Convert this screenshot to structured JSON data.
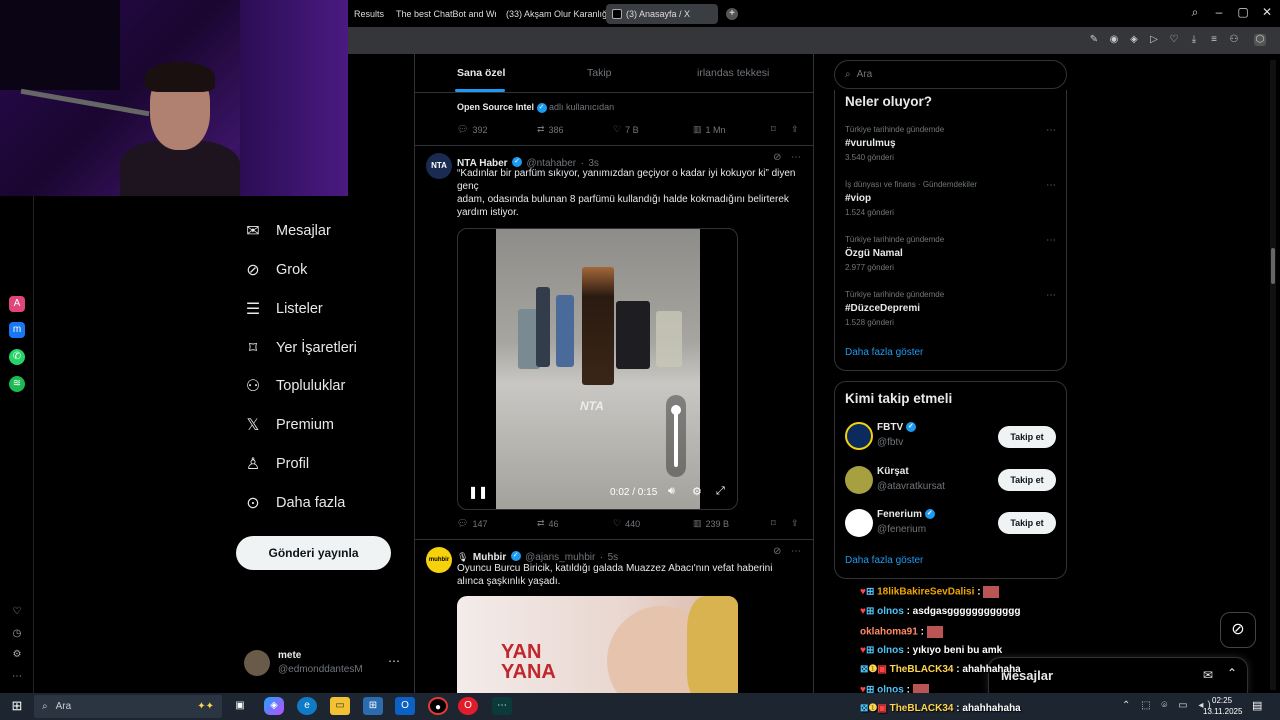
{
  "browser": {
    "tabs": [
      {
        "label": "Results"
      },
      {
        "label": "The best ChatBot and Wri"
      },
      {
        "label": "(33) Akşam Olur Karanlığa"
      },
      {
        "label": "(3) Anasayfa / X"
      }
    ]
  },
  "nav": {
    "items": [
      {
        "label": "Mesajlar",
        "icon": "mail-icon"
      },
      {
        "label": "Grok",
        "icon": "grok-icon"
      },
      {
        "label": "Listeler",
        "icon": "list-icon"
      },
      {
        "label": "Yer İşaretleri",
        "icon": "bookmark-icon"
      },
      {
        "label": "Topluluklar",
        "icon": "communities-icon"
      },
      {
        "label": "Premium",
        "icon": "x-icon"
      },
      {
        "label": "Profil",
        "icon": "profile-icon"
      },
      {
        "label": "Daha fazla",
        "icon": "more-icon"
      }
    ],
    "post_button": "Gönderi yayınla",
    "account": {
      "name": "mete",
      "handle": "@edmonddantesM"
    }
  },
  "timeline": {
    "tabs": [
      "Sana özel",
      "Takip",
      "irlandas tekkesi"
    ],
    "tweet0": {
      "context": "Open Source Intel",
      "context_suffix": "adlı kullanıcıdan",
      "replies": "392",
      "reposts": "386",
      "likes": "7 B",
      "views": "1 Mn"
    },
    "tweet1": {
      "name": "NTA Haber",
      "handle": "@ntahaber",
      "time": "3s",
      "text1": "“Kadınlar bir parfüm sıkıyor, yanımızdan geçiyor o kadar iyi kokuyor ki” diyen genç",
      "text2": "adam, odasında bulunan 8 parfümü kullandığı halde kokmadığını belirterek yardım istiyor.",
      "video_time": "0:02 / 0:15",
      "video_watermark": "NTA",
      "replies": "147",
      "reposts": "46",
      "likes": "440",
      "views": "239 B"
    },
    "tweet2": {
      "name": "Muhbir",
      "handle": "@ajans_muhbir",
      "time": "5s",
      "text": "Oyuncu Burcu Biricik, katıldığı galada Muazzez Abacı'nın vefat haberini alınca şaşkınlık yaşadı.",
      "image_text": "YAN YANA"
    }
  },
  "sidebar": {
    "search_placeholder": "Ara",
    "trends_title": "Neler oluyor?",
    "trends": [
      {
        "meta": "Türkiye tarihinde gündemde",
        "name": "#vurulmuş",
        "count": "3.540 gönderi"
      },
      {
        "meta": "İş dünyası ve finans · Gündemdekiler",
        "name": "#viop",
        "count": "1.524 gönderi"
      },
      {
        "meta": "Türkiye tarihinde gündemde",
        "name": "Özgü Namal",
        "count": "2.977 gönderi"
      },
      {
        "meta": "Türkiye tarihinde gündemde",
        "name": "#DüzceDepremi",
        "count": "1.528 gönderi"
      }
    ],
    "show_more": "Daha fazla göster",
    "who_to_follow_title": "Kimi takip etmeli",
    "follow": [
      {
        "name": "FBTV",
        "handle": "@fbtv",
        "button": "Takip et"
      },
      {
        "name": "Kürşat",
        "handle": "@atavratkursat",
        "button": "Takip et"
      },
      {
        "name": "Fenerium",
        "handle": "@fenerium",
        "button": "Takip et"
      }
    ],
    "show_more2": "Daha fazla göster",
    "messages_label": "Mesajlar"
  },
  "chat": [
    {
      "user": "18likBakireSevDalisi",
      "msg": ":",
      "color": "#f0a500"
    },
    {
      "user": "olnos",
      "msg": ": asdgasgggggggggggg",
      "color": "#4fc3f7"
    },
    {
      "user": "oklahoma91",
      "msg": ":",
      "color": "#ff8a65"
    },
    {
      "user": "olnos",
      "msg": ": yıkıyo beni bu amk",
      "color": "#4fc3f7"
    },
    {
      "user": "TheBLACK34",
      "msg": ": ahahhahaha",
      "color": "#ffd54f"
    },
    {
      "user": "olnos",
      "msg": ":",
      "color": "#4fc3f7"
    },
    {
      "user": "TheBLACK34",
      "msg": ": ahahhahaha",
      "color": "#ffd54f"
    }
  ],
  "taskbar": {
    "search": "Ara",
    "time": "02:25",
    "date": "13.11.2025"
  }
}
